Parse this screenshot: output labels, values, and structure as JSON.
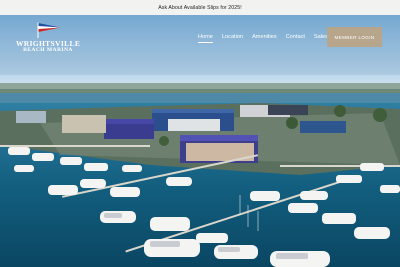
{
  "announcement": {
    "text": "Ask About Available Slips for 2025!"
  },
  "logo": {
    "line1": "WRIGHTSVILLE",
    "line2": "BEACH MARINA"
  },
  "nav": {
    "items": [
      {
        "label": "Home",
        "active": true
      },
      {
        "label": "Location",
        "active": false
      },
      {
        "label": "Amenities",
        "active": false
      },
      {
        "label": "Contact",
        "active": false
      },
      {
        "label": "Sales",
        "active": false
      }
    ]
  },
  "cta": {
    "label": "MEMBER LOGIN"
  },
  "colors": {
    "cta": "#b7a58c",
    "announce_bg": "#f2f2f0",
    "water": "#0d4d6e",
    "sky": "#bcd9ee"
  }
}
